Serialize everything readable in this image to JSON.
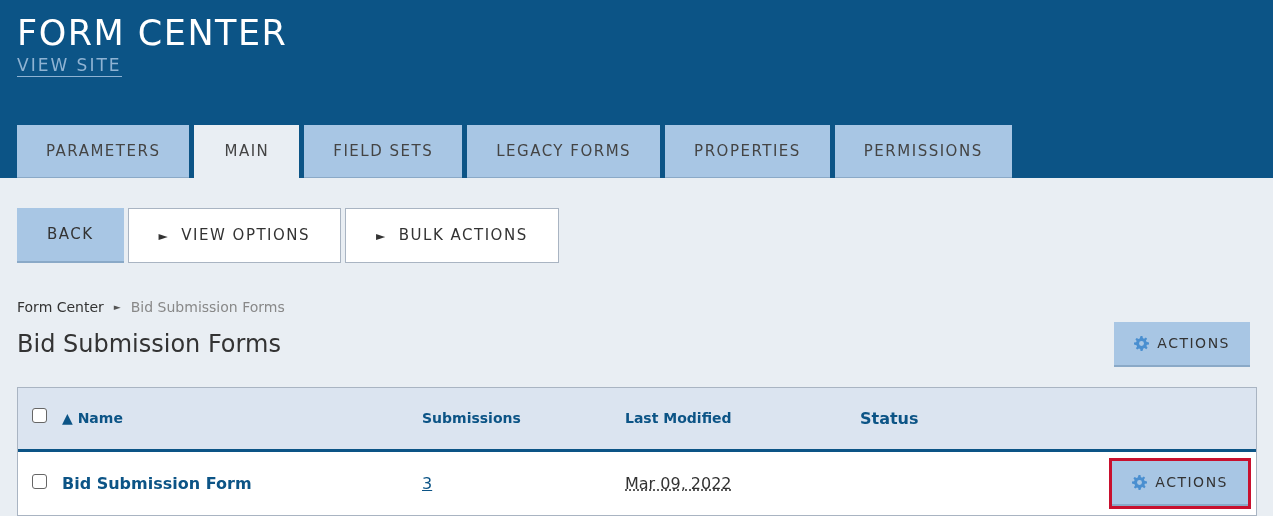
{
  "header": {
    "title": "FORM CENTER",
    "link": "VIEW SITE"
  },
  "tabs": [
    {
      "label": "PARAMETERS",
      "selected": false
    },
    {
      "label": "MAIN",
      "selected": true
    },
    {
      "label": "FIELD SETS",
      "selected": false
    },
    {
      "label": "LEGACY FORMS",
      "selected": false
    },
    {
      "label": "PROPERTIES",
      "selected": false
    },
    {
      "label": "PERMISSIONS",
      "selected": false
    }
  ],
  "toolbar": [
    {
      "kind": "primary",
      "label": "BACK"
    },
    {
      "kind": "toggle",
      "marker": "►",
      "label": "VIEW OPTIONS"
    },
    {
      "kind": "toggle",
      "marker": "►",
      "label": "BULK ACTIONS"
    }
  ],
  "breadcrumb": {
    "items": [
      "Form Center",
      "Bid Submission Forms"
    ],
    "separator": "►"
  },
  "heading": "Bid Submission Forms",
  "actions_button": {
    "label": "ACTIONS"
  },
  "table": {
    "select_all": {
      "checked": false
    },
    "columns": [
      {
        "label": "Name",
        "sort_marker": "▲"
      },
      {
        "label": "Submissions"
      },
      {
        "label": "Last Modified"
      },
      {
        "label": "Status"
      }
    ],
    "rows": [
      {
        "checked": false,
        "name": "Bid Submission Form",
        "submissions": "3",
        "last_modified": "Mar 09, 2022",
        "actions": "ACTIONS",
        "highlighted": true
      }
    ]
  }
}
